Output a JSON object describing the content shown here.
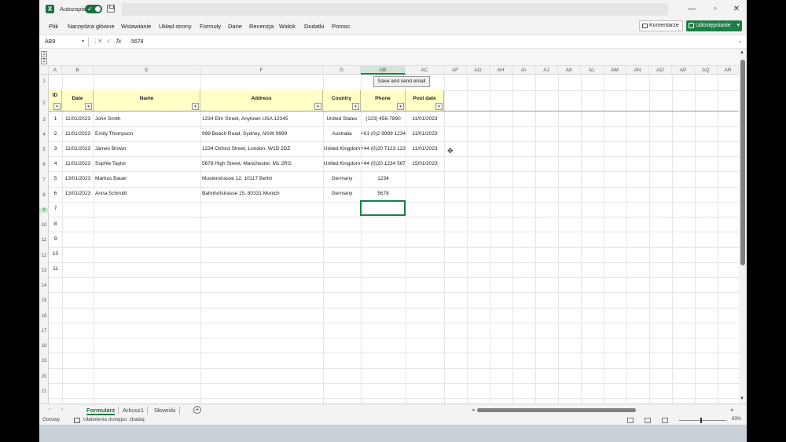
{
  "titlebar": {
    "autosave_label": "Autozapis",
    "app_icon": "X",
    "window_buttons": [
      "—",
      "▫",
      "✕"
    ]
  },
  "menu": {
    "items": [
      "Plik",
      "Narzędzia główne",
      "Wstawianie",
      "Układ strony",
      "Formuły",
      "Dane",
      "Recenzja",
      "Widok",
      "Dodatki",
      "Pomoc"
    ],
    "comments_label": "Komentarze",
    "share_label": "Udostępnianie"
  },
  "formula_bar": {
    "name_box": "AB9",
    "formula": "5678",
    "fx": "fx"
  },
  "columns": [
    "A",
    "B",
    "E",
    "F",
    "G",
    "AB",
    "AC",
    "AF",
    "AG",
    "AH",
    "AI",
    "AJ",
    "AK",
    "AL",
    "AM",
    "AN",
    "AO",
    "AP",
    "AQ",
    "AR"
  ],
  "rows": [
    "1",
    "2",
    "3",
    "4",
    "5",
    "6",
    "7",
    "8",
    "9",
    "10",
    "11",
    "12",
    "13",
    "14",
    "15",
    "16",
    "17",
    "18",
    "19",
    "20",
    "21"
  ],
  "button_label": "Save and send email",
  "table": {
    "headers": [
      "ID",
      "Date",
      "Name",
      "Address",
      "Country",
      "Phone",
      "Post date"
    ],
    "rows": [
      [
        "1",
        "11/01/2023",
        "John Smith",
        "1234 Elm Street, Anytown USA 12345",
        "United States",
        "(123) 456-7890",
        "11/01/2023"
      ],
      [
        "2",
        "11/01/2023",
        "Emily Thompson",
        "999 Beach Road, Sydney, NSW 9999",
        "Australia",
        "+61 (0)2 9999 1234",
        "11/01/2023"
      ],
      [
        "3",
        "11/01/2023",
        "James Brown",
        "1234 Oxford Street, London, W1D 2DZ",
        "United Kingdom",
        "+44 (0)20 7123 1234",
        "11/01/2023"
      ],
      [
        "4",
        "11/01/2023",
        "Sophie Taylor",
        "5678 High Street, Manchester, M1 2RG",
        "United Kingdom",
        "+44 (0)20 1234 5678",
        "15/01/2023"
      ],
      [
        "5",
        "13/01/2023",
        "Markus Bauer",
        "Musterstrasse 12, 10117 Berlin",
        "Germany",
        "1234",
        ""
      ],
      [
        "6",
        "13/01/2023",
        "Anna Schmidt",
        "Bahnhofstrasse 15, 80331 Munich",
        "Germany",
        "5678",
        ""
      ],
      [
        "7",
        "",
        "",
        "",
        "",
        "",
        ""
      ],
      [
        "8",
        "",
        "",
        "",
        "",
        "",
        ""
      ],
      [
        "9",
        "",
        "",
        "",
        "",
        "",
        ""
      ],
      [
        "10",
        "",
        "",
        "",
        "",
        "",
        ""
      ],
      [
        "11",
        "",
        "",
        "",
        "",
        "",
        ""
      ]
    ]
  },
  "sheets": [
    "Formularz",
    "Arkusz1",
    "Słowniki"
  ],
  "status": {
    "ready": "Gotowy",
    "accessibility": "Ułatwienia dostępu: zbadaj",
    "zoom": "83%"
  },
  "colors": {
    "accent": "#1d7e45",
    "header_fill": "#ffffc6"
  }
}
